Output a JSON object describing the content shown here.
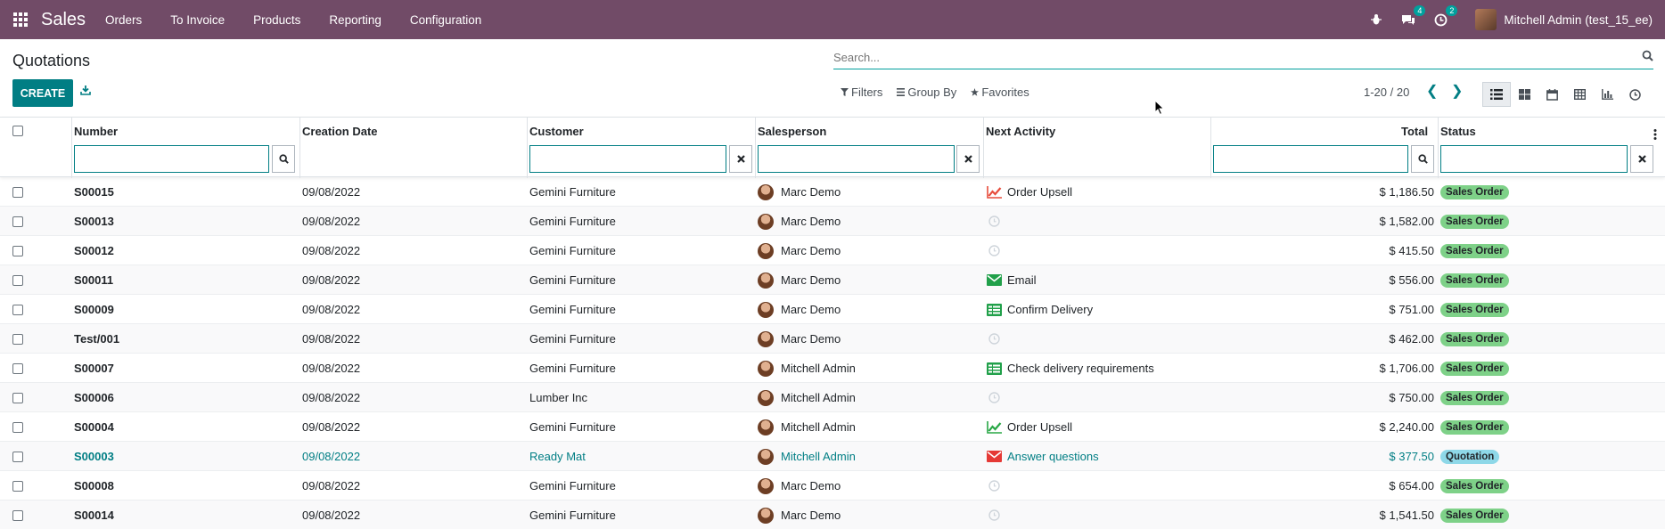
{
  "navbar": {
    "app": "Sales",
    "menu": [
      "Orders",
      "To Invoice",
      "Products",
      "Reporting",
      "Configuration"
    ],
    "messages_count": "4",
    "activities_count": "2",
    "user": "Mitchell Admin (test_15_ee)"
  },
  "page": {
    "title": "Quotations",
    "create_label": "CREATE",
    "search_placeholder": "Search...",
    "filters_label": "Filters",
    "groupby_label": "Group By",
    "favorites_label": "Favorites",
    "pager": "1-20 / 20"
  },
  "columns": {
    "number": "Number",
    "creation_date": "Creation Date",
    "customer": "Customer",
    "salesperson": "Salesperson",
    "next_activity": "Next Activity",
    "total": "Total",
    "status": "Status"
  },
  "colors": {
    "brand": "#714B67",
    "accent": "#017E84",
    "sales_order": "#7ED188",
    "quotation": "#8ED8E8",
    "upsell_red": "#E74C3C",
    "upsell_green": "#28A745",
    "email_green": "#21A04A",
    "email_red": "#E53935",
    "delivery_green": "#21A04A"
  },
  "rows": [
    {
      "number": "S00015",
      "date": "09/08/2022",
      "customer": "Gemini Furniture",
      "salesperson": "Marc Demo",
      "activity": "Order Upsell",
      "activity_icon": "chart-line-icon",
      "activity_color": "#E74C3C",
      "total": "$ 1,186.50",
      "status": "Sales Order"
    },
    {
      "number": "S00013",
      "date": "09/08/2022",
      "customer": "Gemini Furniture",
      "salesperson": "Marc Demo",
      "activity": "",
      "activity_icon": "clock-icon",
      "activity_color": "#CED4DA",
      "total": "$ 1,582.00",
      "status": "Sales Order"
    },
    {
      "number": "S00012",
      "date": "09/08/2022",
      "customer": "Gemini Furniture",
      "salesperson": "Marc Demo",
      "activity": "",
      "activity_icon": "clock-icon",
      "activity_color": "#CED4DA",
      "total": "$ 415.50",
      "status": "Sales Order"
    },
    {
      "number": "S00011",
      "date": "09/08/2022",
      "customer": "Gemini Furniture",
      "salesperson": "Marc Demo",
      "activity": "Email",
      "activity_icon": "envelope-icon",
      "activity_color": "#21A04A",
      "total": "$ 556.00",
      "status": "Sales Order"
    },
    {
      "number": "S00009",
      "date": "09/08/2022",
      "customer": "Gemini Furniture",
      "salesperson": "Marc Demo",
      "activity": "Confirm Delivery",
      "activity_icon": "delivery-icon",
      "activity_color": "#21A04A",
      "total": "$ 751.00",
      "status": "Sales Order"
    },
    {
      "number": "Test/001",
      "date": "09/08/2022",
      "customer": "Gemini Furniture",
      "salesperson": "Marc Demo",
      "activity": "",
      "activity_icon": "clock-icon",
      "activity_color": "#CED4DA",
      "total": "$ 462.00",
      "status": "Sales Order"
    },
    {
      "number": "S00007",
      "date": "09/08/2022",
      "customer": "Gemini Furniture",
      "salesperson": "Mitchell Admin",
      "activity": "Check delivery requirements",
      "activity_icon": "delivery-icon",
      "activity_color": "#21A04A",
      "total": "$ 1,706.00",
      "status": "Sales Order"
    },
    {
      "number": "S00006",
      "date": "09/08/2022",
      "customer": "Lumber Inc",
      "salesperson": "Mitchell Admin",
      "activity": "",
      "activity_icon": "clock-icon",
      "activity_color": "#CED4DA",
      "total": "$ 750.00",
      "status": "Sales Order"
    },
    {
      "number": "S00004",
      "date": "09/08/2022",
      "customer": "Gemini Furniture",
      "salesperson": "Mitchell Admin",
      "activity": "Order Upsell",
      "activity_icon": "chart-line-icon",
      "activity_color": "#28A745",
      "total": "$ 2,240.00",
      "status": "Sales Order"
    },
    {
      "number": "S00003",
      "date": "09/08/2022",
      "customer": "Ready Mat",
      "salesperson": "Mitchell Admin",
      "activity": "Answer questions",
      "activity_icon": "envelope-icon",
      "activity_color": "#E53935",
      "total": "$ 377.50",
      "status": "Quotation",
      "highlight": true
    },
    {
      "number": "S00008",
      "date": "09/08/2022",
      "customer": "Gemini Furniture",
      "salesperson": "Marc Demo",
      "activity": "",
      "activity_icon": "clock-icon",
      "activity_color": "#CED4DA",
      "total": "$ 654.00",
      "status": "Sales Order"
    },
    {
      "number": "S00014",
      "date": "09/08/2022",
      "customer": "Gemini Furniture",
      "salesperson": "Marc Demo",
      "activity": "",
      "activity_icon": "clock-icon",
      "activity_color": "#CED4DA",
      "total": "$ 1,541.50",
      "status": "Sales Order"
    }
  ]
}
